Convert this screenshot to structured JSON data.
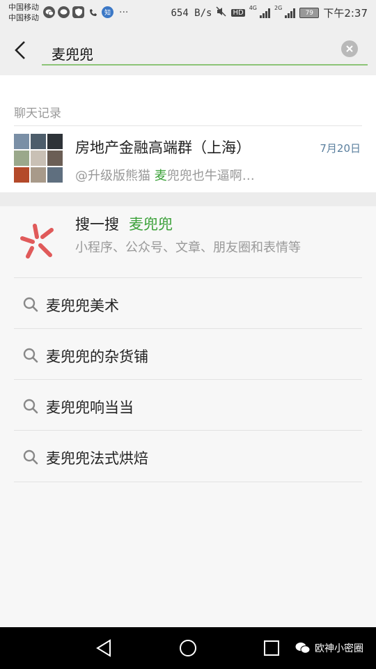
{
  "status_bar": {
    "carrier_1": "中国移动",
    "carrier_2": "中国移动",
    "app_icons": [
      "wechat-icon",
      "chat-icon",
      "shield-icon",
      "phone-icon",
      "zhihu-icon"
    ],
    "zhihu_label": "知",
    "more": "···",
    "net_speed": "654 B/s",
    "hd": "HD",
    "gen_1": "4G",
    "gen_2": "2G",
    "battery": "79",
    "time": "下午2:37"
  },
  "search": {
    "query": "麦兜兜"
  },
  "chat_records": {
    "section_label": "聊天记录",
    "items": [
      {
        "title": "房地产金融高端群（上海）",
        "date": "7月20日",
        "snippet_prefix": "@升级版熊猫 ",
        "snippet_highlight": "麦",
        "snippet_suffix": "兜兜也牛逼啊…"
      }
    ]
  },
  "search_one_search": {
    "title": "搜一搜",
    "keyword": "麦兜兜",
    "description": "小程序、公众号、文章、朋友圈和表情等"
  },
  "suggestions": [
    "麦兜兜美术",
    "麦兜兜的杂货铺",
    "麦兜兜响当当",
    "麦兜兜法式烘焙"
  ],
  "watermark": "欧神小密圈",
  "colors": {
    "highlight": "#3ca13a",
    "accent_underline": "#8cc477",
    "date": "#5a7f9e",
    "souyisou_icon": "#e05a5a"
  }
}
